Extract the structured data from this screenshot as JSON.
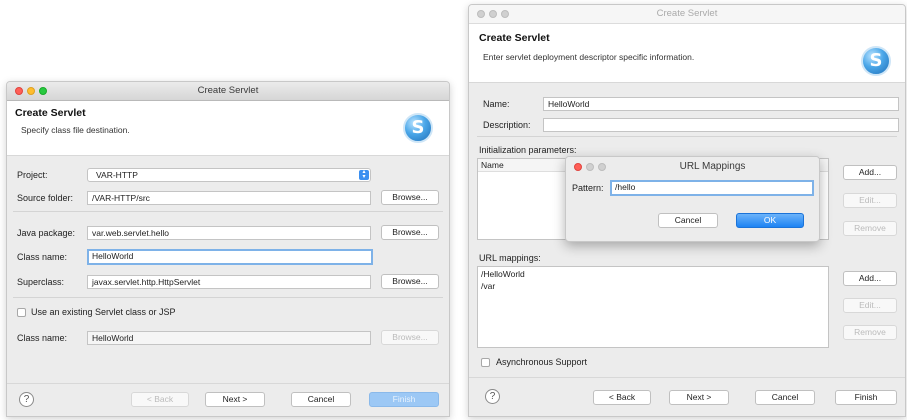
{
  "left_dialog": {
    "title": "Create Servlet",
    "header_title": "Create Servlet",
    "header_subtitle": "Specify class file destination.",
    "project_label": "Project:",
    "project_value": "VAR-HTTP",
    "source_folder_label": "Source folder:",
    "source_folder_value": "/VAR-HTTP/src",
    "browse": "Browse...",
    "java_package_label": "Java package:",
    "java_package_value": "var.web.servlet.hello",
    "class_name_label": "Class name:",
    "class_name_value": "HelloWorld",
    "superclass_label": "Superclass:",
    "superclass_value": "javax.servlet.http.HttpServlet",
    "use_existing_label": "Use an existing Servlet class or JSP",
    "class_name2_label": "Class name:",
    "class_name2_value": "HelloWorld",
    "help": "?",
    "back": "< Back",
    "next": "Next >",
    "cancel": "Cancel",
    "finish": "Finish"
  },
  "right_dialog": {
    "title": "Create Servlet",
    "header_title": "Create Servlet",
    "header_subtitle": "Enter servlet deployment descriptor specific information.",
    "name_label": "Name:",
    "name_value": "HelloWorld",
    "description_label": "Description:",
    "description_value": "",
    "init_params_label": "Initialization parameters:",
    "table_col_name": "Name",
    "add": "Add...",
    "edit": "Edit...",
    "remove": "Remove",
    "url_mappings_label": "URL mappings:",
    "url_mappings": [
      "/HelloWorld",
      "/var"
    ],
    "async_label": "Asynchronous Support",
    "help": "?",
    "back": "< Back",
    "next": "Next >",
    "cancel": "Cancel",
    "finish": "Finish"
  },
  "url_dialog": {
    "title": "URL Mappings",
    "pattern_label": "Pattern:",
    "pattern_value": "/hello",
    "cancel": "Cancel",
    "ok": "OK"
  },
  "logo_letter": "S",
  "colors": {
    "accent": "#1d83f3",
    "close": "#ff5f57",
    "minimize": "#ffbd2e",
    "zoom": "#28c940"
  }
}
